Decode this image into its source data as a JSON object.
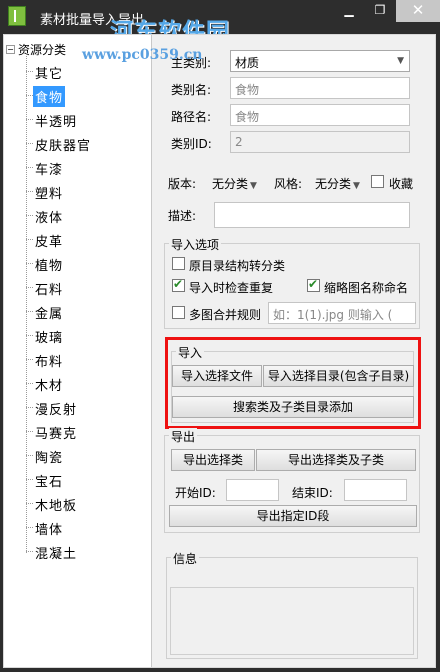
{
  "window": {
    "title": "素材批量导入导出",
    "min_icon": "minimize-icon",
    "max_icon": "maximize-icon",
    "close_icon": "close-icon",
    "close_color": "#c7c7c7"
  },
  "watermark": {
    "text": "河东软件园",
    "url": "www.pc0359.cn"
  },
  "tree": {
    "root_label": "资源分类",
    "items": [
      "其它",
      "食物",
      "半透明",
      "皮肤器官",
      "车漆",
      "塑料",
      "液体",
      "皮革",
      "植物",
      "石料",
      "金属",
      "玻璃",
      "布料",
      "木材",
      "漫反射",
      "马赛克",
      "陶瓷",
      "宝石",
      "木地板",
      "墙体",
      "混凝土"
    ],
    "selected_index": 1
  },
  "form": {
    "main_category_label": "主类别:",
    "main_category_value": "材质",
    "category_name_label": "类别名:",
    "category_name_value": "食物",
    "path_name_label": "路径名:",
    "path_name_value": "食物",
    "category_id_label": "类别ID:",
    "category_id_value": "2",
    "version_label": "版本:",
    "version_value": "无分类",
    "style_label": "风格:",
    "style_value": "无分类",
    "favorite_label": "收藏",
    "description_label": "描述:"
  },
  "import_options": {
    "title": "导入选项",
    "opt1_label": "原目录结构转分类",
    "opt2_label": "导入时检查重复",
    "opt3_label": "缩略图名称命名",
    "opt4_label": "多图合并规则",
    "opt4_placeholder": "如：1(1).jpg 则输入 (",
    "checks": {
      "opt1": false,
      "opt2": true,
      "opt3": true,
      "opt4": false
    }
  },
  "import": {
    "title": "导入",
    "btn_file": "导入选择文件",
    "btn_dir": "导入选择目录(包含子目录)",
    "btn_search": "搜索类及子类目录添加",
    "highlight_color": "#ee1111"
  },
  "export": {
    "title": "导出",
    "btn_export_category": "导出选择类",
    "btn_export_with_sub": "导出选择类及子类",
    "start_id_label": "开始ID:",
    "end_id_label": "结束ID:",
    "btn_export_id": "导出指定ID段"
  },
  "info": {
    "title": "信息"
  }
}
